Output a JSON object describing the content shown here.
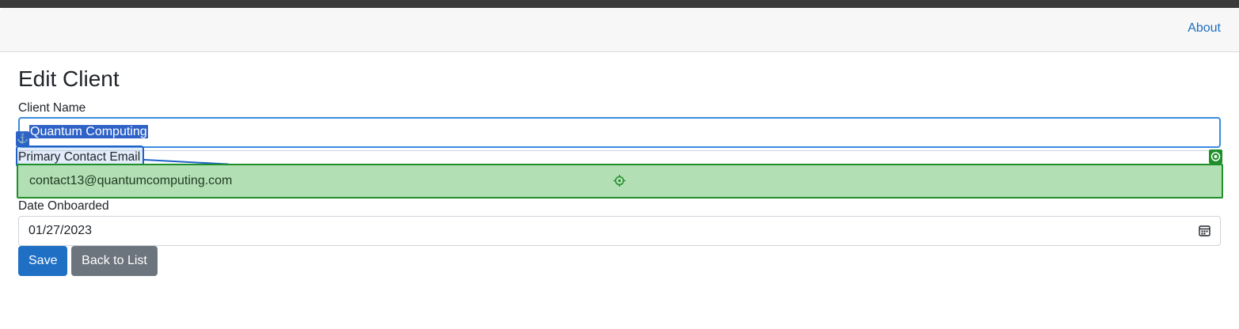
{
  "nav": {
    "about_label": "About"
  },
  "page": {
    "title": "Edit Client"
  },
  "form": {
    "client_name": {
      "label": "Client Name",
      "value": "Quantum Computing"
    },
    "primary_contact_email": {
      "label": "Primary Contact Email",
      "value": "contact13@quantumcomputing.com"
    },
    "date_onboarded": {
      "label": "Date Onboarded",
      "value": "01/27/2023"
    }
  },
  "buttons": {
    "save_label": "Save",
    "back_label": "Back to List"
  },
  "colors": {
    "primary": "#1f6fc5",
    "secondary": "#6c757d",
    "selection": "#2f62c7",
    "highlight_green": "#1f8f2a"
  },
  "icons": {
    "anchor": "anchor-icon",
    "target": "crosshair-icon",
    "calendar": "calendar-icon",
    "badge": "target-badge-icon"
  }
}
